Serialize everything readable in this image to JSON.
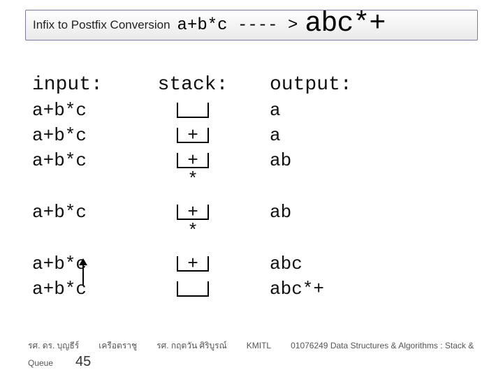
{
  "header": {
    "title_prefix": "Infix to Postfix Conversion",
    "expr": "a+b*c  ---- >",
    "result": "abc*+"
  },
  "table": {
    "headers": {
      "input": "input:",
      "stack": "stack:",
      "output": "output:"
    },
    "rows": [
      {
        "input": "a+b*c",
        "stack_top": "",
        "stack_extra": "",
        "output": "a"
      },
      {
        "input": "a+b*c",
        "stack_top": "+",
        "stack_extra": "",
        "output": "a"
      },
      {
        "input": "a+b*c",
        "stack_top": "+",
        "stack_extra": "*",
        "output": "ab"
      },
      {
        "gap": true
      },
      {
        "input": "a+b*c",
        "stack_top": "+",
        "stack_extra": "*",
        "output": "ab"
      },
      {
        "gap": true
      },
      {
        "input": "a+b*c",
        "stack_top": "+",
        "stack_extra": "",
        "output": "abc"
      },
      {
        "input": "a+b*c",
        "stack_top": "",
        "stack_extra": "",
        "output": "abc*+"
      }
    ]
  },
  "footer": {
    "author1": "รศ. ดร. บุญธีร์",
    "author2": "เครือตราชู",
    "author3": "รศ. กฤตวัน     ศิริบูรณ์",
    "inst": "KMITL",
    "course": "01076249 Data Structures & Algorithms : Stack &",
    "label2": "Queue",
    "page": "45"
  }
}
